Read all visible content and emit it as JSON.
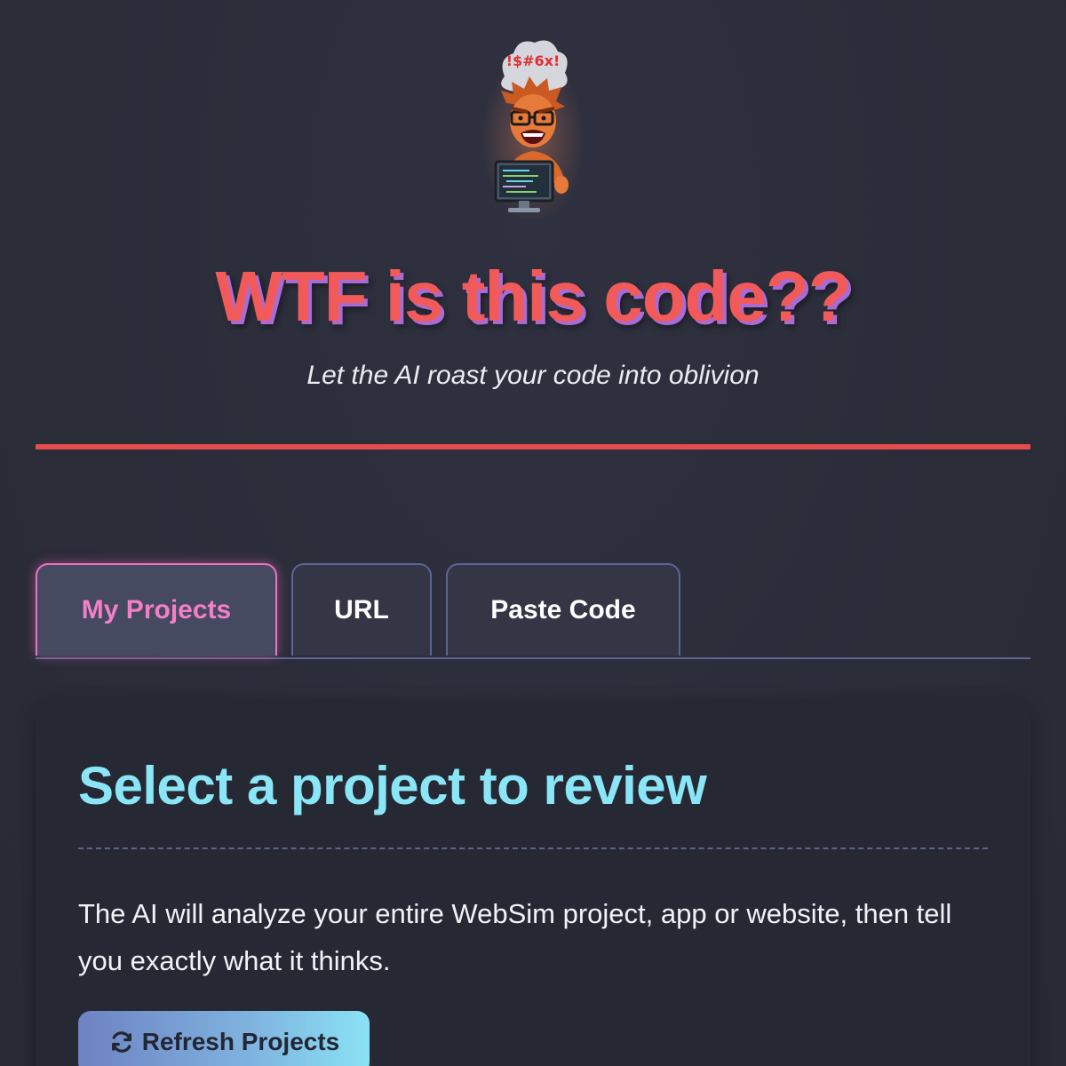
{
  "header": {
    "title": "WTF is this code??",
    "subtitle": "Let the AI roast your code into oblivion",
    "mascot_icon": "angry-programmer-mascot",
    "mascot_swear": "!$#6x!"
  },
  "tabs": [
    {
      "label": "My Projects",
      "active": true
    },
    {
      "label": "URL",
      "active": false
    },
    {
      "label": "Paste Code",
      "active": false
    }
  ],
  "panel": {
    "title": "Select a project to review",
    "description": "The AI will analyze your entire WebSim project, app or website, then tell you exactly what it thinks.",
    "refresh_button": {
      "label": "Refresh Projects",
      "icon": "refresh-icon"
    }
  },
  "colors": {
    "background": "#2b2d3a",
    "title": "#f25a5a",
    "title_shadow": "#a66bd6",
    "accent_red": "#e84b4b",
    "tab_active": "#f47ec8",
    "tab_border": "#5b6594",
    "panel_title": "#8ae6f7"
  }
}
